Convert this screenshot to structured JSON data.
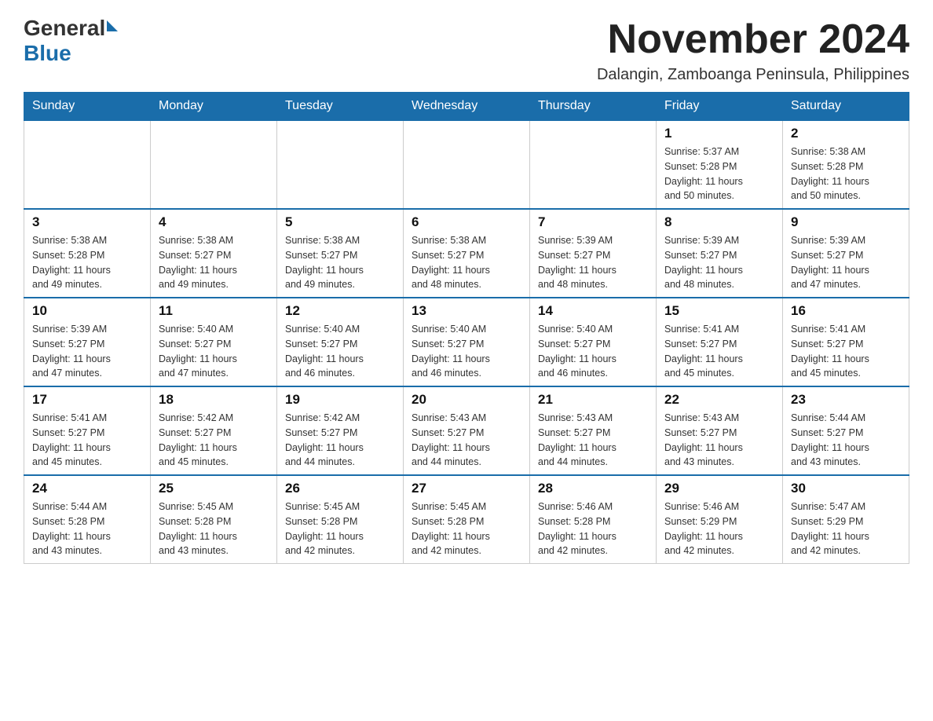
{
  "header": {
    "logo_general": "General",
    "logo_blue": "Blue",
    "month_title": "November 2024",
    "location": "Dalangin, Zamboanga Peninsula, Philippines"
  },
  "columns": [
    "Sunday",
    "Monday",
    "Tuesday",
    "Wednesday",
    "Thursday",
    "Friday",
    "Saturday"
  ],
  "weeks": [
    [
      {
        "day": "",
        "info": ""
      },
      {
        "day": "",
        "info": ""
      },
      {
        "day": "",
        "info": ""
      },
      {
        "day": "",
        "info": ""
      },
      {
        "day": "",
        "info": ""
      },
      {
        "day": "1",
        "info": "Sunrise: 5:37 AM\nSunset: 5:28 PM\nDaylight: 11 hours\nand 50 minutes."
      },
      {
        "day": "2",
        "info": "Sunrise: 5:38 AM\nSunset: 5:28 PM\nDaylight: 11 hours\nand 50 minutes."
      }
    ],
    [
      {
        "day": "3",
        "info": "Sunrise: 5:38 AM\nSunset: 5:28 PM\nDaylight: 11 hours\nand 49 minutes."
      },
      {
        "day": "4",
        "info": "Sunrise: 5:38 AM\nSunset: 5:27 PM\nDaylight: 11 hours\nand 49 minutes."
      },
      {
        "day": "5",
        "info": "Sunrise: 5:38 AM\nSunset: 5:27 PM\nDaylight: 11 hours\nand 49 minutes."
      },
      {
        "day": "6",
        "info": "Sunrise: 5:38 AM\nSunset: 5:27 PM\nDaylight: 11 hours\nand 48 minutes."
      },
      {
        "day": "7",
        "info": "Sunrise: 5:39 AM\nSunset: 5:27 PM\nDaylight: 11 hours\nand 48 minutes."
      },
      {
        "day": "8",
        "info": "Sunrise: 5:39 AM\nSunset: 5:27 PM\nDaylight: 11 hours\nand 48 minutes."
      },
      {
        "day": "9",
        "info": "Sunrise: 5:39 AM\nSunset: 5:27 PM\nDaylight: 11 hours\nand 47 minutes."
      }
    ],
    [
      {
        "day": "10",
        "info": "Sunrise: 5:39 AM\nSunset: 5:27 PM\nDaylight: 11 hours\nand 47 minutes."
      },
      {
        "day": "11",
        "info": "Sunrise: 5:40 AM\nSunset: 5:27 PM\nDaylight: 11 hours\nand 47 minutes."
      },
      {
        "day": "12",
        "info": "Sunrise: 5:40 AM\nSunset: 5:27 PM\nDaylight: 11 hours\nand 46 minutes."
      },
      {
        "day": "13",
        "info": "Sunrise: 5:40 AM\nSunset: 5:27 PM\nDaylight: 11 hours\nand 46 minutes."
      },
      {
        "day": "14",
        "info": "Sunrise: 5:40 AM\nSunset: 5:27 PM\nDaylight: 11 hours\nand 46 minutes."
      },
      {
        "day": "15",
        "info": "Sunrise: 5:41 AM\nSunset: 5:27 PM\nDaylight: 11 hours\nand 45 minutes."
      },
      {
        "day": "16",
        "info": "Sunrise: 5:41 AM\nSunset: 5:27 PM\nDaylight: 11 hours\nand 45 minutes."
      }
    ],
    [
      {
        "day": "17",
        "info": "Sunrise: 5:41 AM\nSunset: 5:27 PM\nDaylight: 11 hours\nand 45 minutes."
      },
      {
        "day": "18",
        "info": "Sunrise: 5:42 AM\nSunset: 5:27 PM\nDaylight: 11 hours\nand 45 minutes."
      },
      {
        "day": "19",
        "info": "Sunrise: 5:42 AM\nSunset: 5:27 PM\nDaylight: 11 hours\nand 44 minutes."
      },
      {
        "day": "20",
        "info": "Sunrise: 5:43 AM\nSunset: 5:27 PM\nDaylight: 11 hours\nand 44 minutes."
      },
      {
        "day": "21",
        "info": "Sunrise: 5:43 AM\nSunset: 5:27 PM\nDaylight: 11 hours\nand 44 minutes."
      },
      {
        "day": "22",
        "info": "Sunrise: 5:43 AM\nSunset: 5:27 PM\nDaylight: 11 hours\nand 43 minutes."
      },
      {
        "day": "23",
        "info": "Sunrise: 5:44 AM\nSunset: 5:27 PM\nDaylight: 11 hours\nand 43 minutes."
      }
    ],
    [
      {
        "day": "24",
        "info": "Sunrise: 5:44 AM\nSunset: 5:28 PM\nDaylight: 11 hours\nand 43 minutes."
      },
      {
        "day": "25",
        "info": "Sunrise: 5:45 AM\nSunset: 5:28 PM\nDaylight: 11 hours\nand 43 minutes."
      },
      {
        "day": "26",
        "info": "Sunrise: 5:45 AM\nSunset: 5:28 PM\nDaylight: 11 hours\nand 42 minutes."
      },
      {
        "day": "27",
        "info": "Sunrise: 5:45 AM\nSunset: 5:28 PM\nDaylight: 11 hours\nand 42 minutes."
      },
      {
        "day": "28",
        "info": "Sunrise: 5:46 AM\nSunset: 5:28 PM\nDaylight: 11 hours\nand 42 minutes."
      },
      {
        "day": "29",
        "info": "Sunrise: 5:46 AM\nSunset: 5:29 PM\nDaylight: 11 hours\nand 42 minutes."
      },
      {
        "day": "30",
        "info": "Sunrise: 5:47 AM\nSunset: 5:29 PM\nDaylight: 11 hours\nand 42 minutes."
      }
    ]
  ]
}
